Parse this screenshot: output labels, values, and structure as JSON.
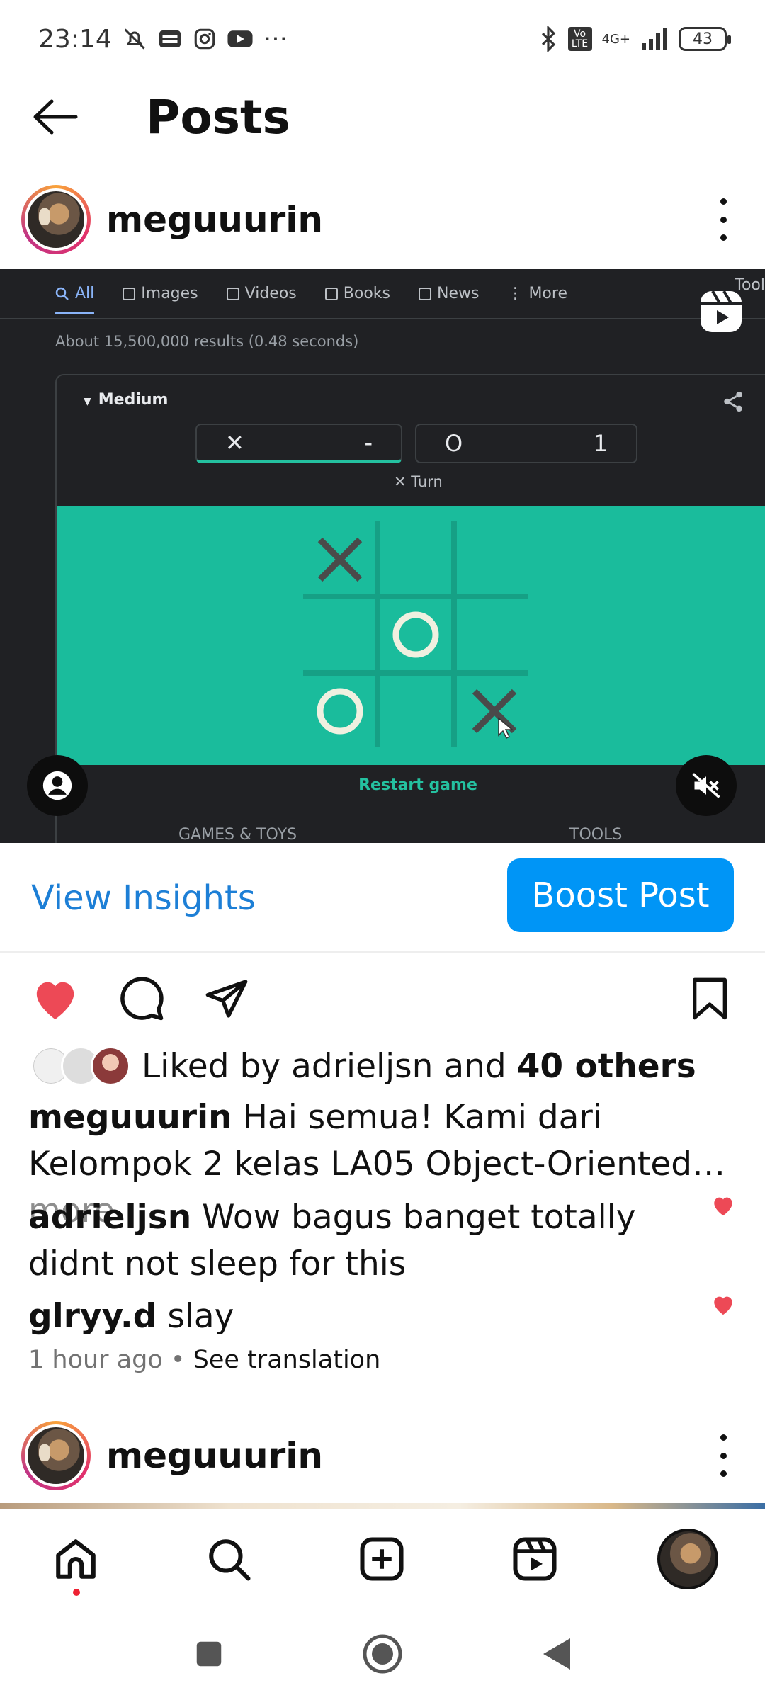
{
  "status_bar": {
    "time": "23:14",
    "more": "···",
    "network": "4G+",
    "volte": "Vo LTE",
    "battery": "43"
  },
  "header": {
    "title": "Posts"
  },
  "post": {
    "username": "meguuurin",
    "media": {
      "search_tabs": [
        "All",
        "Images",
        "Videos",
        "Books",
        "News",
        "More"
      ],
      "tools_partial": "Tool",
      "results_text": "About 15,500,000 results (0.48 seconds)",
      "difficulty": "Medium",
      "score_x_symbol": "✕",
      "score_x_value": "-",
      "score_o_symbol": "O",
      "score_o_value": "1",
      "turn_text": "✕ Turn",
      "restart": "Restart game",
      "footer_left": "GAMES & TOYS",
      "footer_right": "TOOLS"
    },
    "view_insights": "View Insights",
    "boost_post": "Boost Post",
    "likes": {
      "prefix": "Liked by ",
      "user": "adrieljsn",
      "middle": " and ",
      "count": "40 others"
    },
    "caption": {
      "user": "meguuurin",
      "text": " Hai semua! Kami dari Kelompok 2 kelas LA05 Object-Oriented…",
      "more": " more"
    },
    "comments": [
      {
        "user": "adrieljsn",
        "text": " Wow bagus banget totally didnt not sleep for this"
      },
      {
        "user": "glryy.d",
        "text": " slay"
      }
    ],
    "time_ago": "1 hour ago",
    "separator": " • ",
    "see_translation": "See translation"
  },
  "next_post": {
    "username": "meguuurin"
  },
  "colors": {
    "accent": "#0095f6",
    "link": "#1d7fd6",
    "like": "#ed4956",
    "board": "#1abc9c"
  }
}
